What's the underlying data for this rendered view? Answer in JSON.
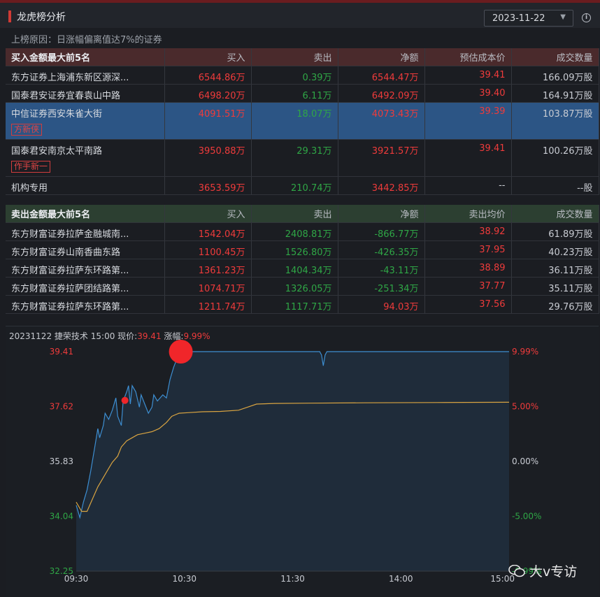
{
  "header": {
    "title": "龙虎榜分析",
    "date": "2023-11-22"
  },
  "reason": "上榜原因：日涨幅偏离值达7%的证券",
  "buy_table": {
    "headers": [
      "买入金额最大前5名",
      "买入",
      "卖出",
      "净额",
      "预估成本价",
      "成交数量"
    ],
    "rows": [
      {
        "name": "东方证券上海浦东新区源深...",
        "buy": "6544.86万",
        "sell": "0.39万",
        "net": "6544.47万",
        "cost": "39.41",
        "volume": "166.09万股"
      },
      {
        "name": "国泰君安证券宜春袁山中路",
        "buy": "6498.20万",
        "sell": "6.11万",
        "net": "6492.09万",
        "cost": "39.40",
        "volume": "164.91万股"
      },
      {
        "name": "中信证券西安朱雀大街",
        "tag": "方新侠",
        "buy": "4091.51万",
        "sell": "18.07万",
        "net": "4073.43万",
        "cost": "39.39",
        "volume": "103.87万股"
      },
      {
        "name": "国泰君安南京太平南路",
        "tag": "作手新一",
        "buy": "3950.88万",
        "sell": "29.31万",
        "net": "3921.57万",
        "cost": "39.41",
        "volume": "100.26万股"
      },
      {
        "name": "机构专用",
        "buy": "3653.59万",
        "sell": "210.74万",
        "net": "3442.85万",
        "cost": "--",
        "volume": "--股"
      }
    ]
  },
  "sell_table": {
    "headers": [
      "卖出金额最大前5名",
      "买入",
      "卖出",
      "净额",
      "卖出均价",
      "成交数量"
    ],
    "rows": [
      {
        "name": "东方财富证券拉萨金融城南...",
        "buy": "1542.04万",
        "sell": "2408.81万",
        "net": "-866.77万",
        "price": "38.92",
        "volume": "61.89万股"
      },
      {
        "name": "东方财富证券山南香曲东路",
        "buy": "1100.45万",
        "sell": "1526.80万",
        "net": "-426.35万",
        "price": "37.95",
        "volume": "40.23万股"
      },
      {
        "name": "东方财富证券拉萨东环路第...",
        "buy": "1361.23万",
        "sell": "1404.34万",
        "net": "-43.11万",
        "price": "38.89",
        "volume": "36.11万股"
      },
      {
        "name": "东方财富证券拉萨团结路第...",
        "buy": "1074.71万",
        "sell": "1326.05万",
        "net": "-251.34万",
        "price": "37.77",
        "volume": "35.11万股"
      },
      {
        "name": "东方财富证券拉萨东环路第...",
        "buy": "1211.74万",
        "sell": "1117.71万",
        "net": "94.03万",
        "price": "37.56",
        "volume": "29.76万股"
      }
    ]
  },
  "chart_info": {
    "date": "20231122",
    "stock": "捷荣技术",
    "time": "15:00",
    "price_label": "现价:",
    "price": "39.41",
    "change_label": "涨幅:",
    "change": "9.99%"
  },
  "watermark": "大v专访",
  "chart_data": {
    "type": "line",
    "ylim": [
      32.25,
      39.41
    ],
    "y_ticks_left": [
      "39.41",
      "37.62",
      "35.83",
      "34.04",
      "32.25"
    ],
    "y_ticks_right": [
      "9.99%",
      "5.00%",
      "0.00%",
      "-5.00%",
      "-9.99%"
    ],
    "x_ticks": [
      "09:30",
      "10:30",
      "11:30",
      "14:00",
      "15:00"
    ],
    "colors": {
      "price": "#3d8ed1",
      "avg": "#d9a441",
      "fill": "#1f2c3a",
      "up": "#ef3b3b",
      "down": "#2fa646",
      "flat": "#c9ccd3"
    },
    "series": [
      {
        "values": [
          [
            0,
            34.4
          ],
          [
            2,
            34.0
          ],
          [
            4,
            34.5
          ],
          [
            6,
            34.9
          ],
          [
            8,
            35.5
          ],
          [
            10,
            36.2
          ],
          [
            12,
            36.9
          ],
          [
            13,
            36.6
          ],
          [
            15,
            37.0
          ],
          [
            16,
            37.4
          ],
          [
            18,
            37.2
          ],
          [
            20,
            37.5
          ],
          [
            22,
            37.9
          ],
          [
            23,
            37.3
          ],
          [
            25,
            37.0
          ],
          [
            26,
            37.8
          ],
          [
            28,
            38.1
          ],
          [
            29,
            38.3
          ],
          [
            30,
            37.7
          ],
          [
            31,
            38.3
          ],
          [
            33,
            38.1
          ],
          [
            35,
            37.6
          ],
          [
            36,
            38.0
          ],
          [
            38,
            37.7
          ],
          [
            40,
            37.4
          ],
          [
            42,
            37.6
          ],
          [
            43,
            38.0
          ],
          [
            45,
            37.8
          ],
          [
            48,
            38.0
          ],
          [
            50,
            37.9
          ],
          [
            52,
            38.5
          ],
          [
            54,
            38.9
          ],
          [
            56,
            39.2
          ],
          [
            58,
            39.41
          ],
          [
            62,
            39.41
          ],
          [
            100,
            39.41
          ],
          [
            135,
            39.41
          ],
          [
            136,
            39.3
          ],
          [
            137,
            38.95
          ],
          [
            138,
            39.3
          ],
          [
            139,
            39.41
          ],
          [
            240,
            39.41
          ]
        ]
      },
      {
        "values": [
          [
            0,
            34.5
          ],
          [
            3,
            34.2
          ],
          [
            6,
            34.2
          ],
          [
            9,
            34.6
          ],
          [
            12,
            35.0
          ],
          [
            15,
            35.3
          ],
          [
            18,
            35.6
          ],
          [
            20,
            35.8
          ],
          [
            23,
            36.0
          ],
          [
            25,
            36.3
          ],
          [
            28,
            36.5
          ],
          [
            31,
            36.6
          ],
          [
            34,
            36.7
          ],
          [
            38,
            36.75
          ],
          [
            42,
            36.8
          ],
          [
            46,
            36.9
          ],
          [
            50,
            37.1
          ],
          [
            53,
            37.3
          ],
          [
            57,
            37.4
          ],
          [
            62,
            37.42
          ],
          [
            70,
            37.45
          ],
          [
            80,
            37.46
          ],
          [
            90,
            37.5
          ],
          [
            95,
            37.6
          ],
          [
            100,
            37.7
          ],
          [
            110,
            37.72
          ],
          [
            130,
            37.73
          ],
          [
            160,
            37.74
          ],
          [
            200,
            37.75
          ],
          [
            240,
            37.76
          ]
        ]
      }
    ],
    "markers": [
      {
        "x": 27,
        "y": 37.82
      },
      {
        "x": 58,
        "y": 39.41
      }
    ]
  }
}
